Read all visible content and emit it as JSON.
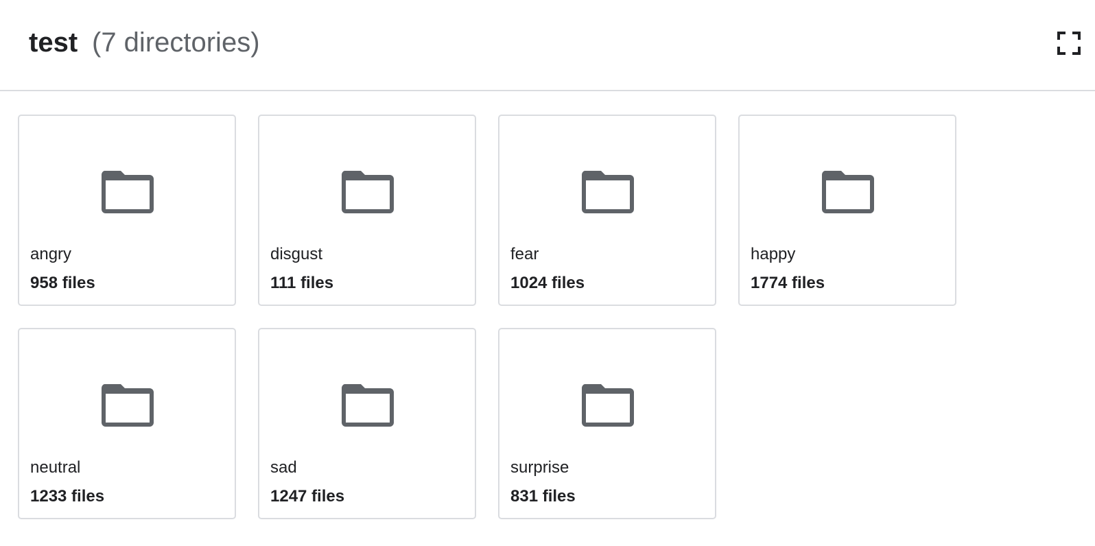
{
  "header": {
    "title": "test",
    "subtitle": "(7 directories)",
    "expand_icon": "fullscreen-icon"
  },
  "colors": {
    "folder_icon": "#5f6368",
    "card_border": "#dadce0",
    "text": "#202124",
    "muted_text": "#5f6368"
  },
  "directories": [
    {
      "name": "angry",
      "count": "958 files",
      "icon": "folder-icon"
    },
    {
      "name": "disgust",
      "count": "111 files",
      "icon": "folder-icon"
    },
    {
      "name": "fear",
      "count": "1024 files",
      "icon": "folder-icon"
    },
    {
      "name": "happy",
      "count": "1774 files",
      "icon": "folder-icon"
    },
    {
      "name": "neutral",
      "count": "1233 files",
      "icon": "folder-icon"
    },
    {
      "name": "sad",
      "count": "1247 files",
      "icon": "folder-icon"
    },
    {
      "name": "surprise",
      "count": "831 files",
      "icon": "folder-icon"
    }
  ]
}
